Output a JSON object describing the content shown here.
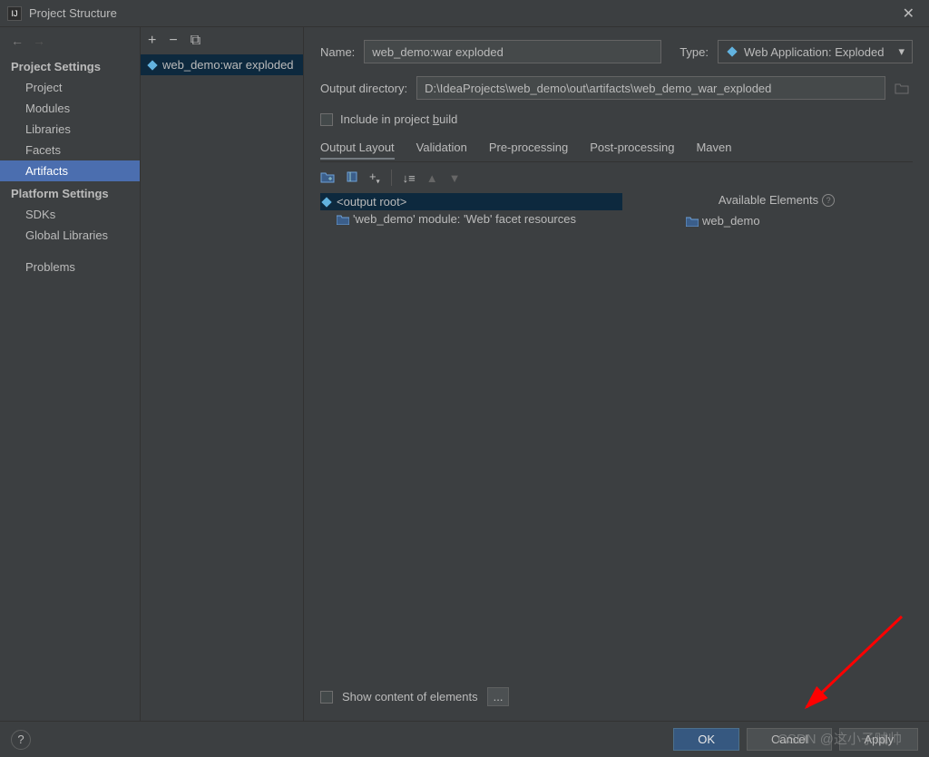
{
  "window": {
    "title": "Project Structure"
  },
  "sidebar": {
    "group1_title": "Project Settings",
    "group1": [
      "Project",
      "Modules",
      "Libraries",
      "Facets",
      "Artifacts"
    ],
    "selected": "Artifacts",
    "group2_title": "Platform Settings",
    "group2": [
      "SDKs",
      "Global Libraries"
    ],
    "group3": [
      "Problems"
    ]
  },
  "artifacts_list": {
    "items": [
      {
        "label": "web_demo:war exploded"
      }
    ]
  },
  "form": {
    "name_label": "Name:",
    "name_value": "web_demo:war exploded",
    "type_label": "Type:",
    "type_value": "Web Application: Exploded",
    "outdir_label": "Output directory:",
    "outdir_value": "D:\\IdeaProjects\\web_demo\\out\\artifacts\\web_demo_war_exploded",
    "include_label_pre": "Include in project ",
    "include_label_u": "b",
    "include_label_post": "uild"
  },
  "tabs": [
    "Output Layout",
    "Validation",
    "Pre-processing",
    "Post-processing",
    "Maven"
  ],
  "tree": {
    "root": "<output root>",
    "child1": "'web_demo' module: 'Web' facet resources",
    "available_header": "Available Elements",
    "available_item": "web_demo"
  },
  "bottom": {
    "show_label": "Show content of elements",
    "ellipsis": "..."
  },
  "footer": {
    "ok": "OK",
    "cancel": "Cancel",
    "apply": "Apply"
  },
  "watermark": "CSDN @这小子贼帅"
}
